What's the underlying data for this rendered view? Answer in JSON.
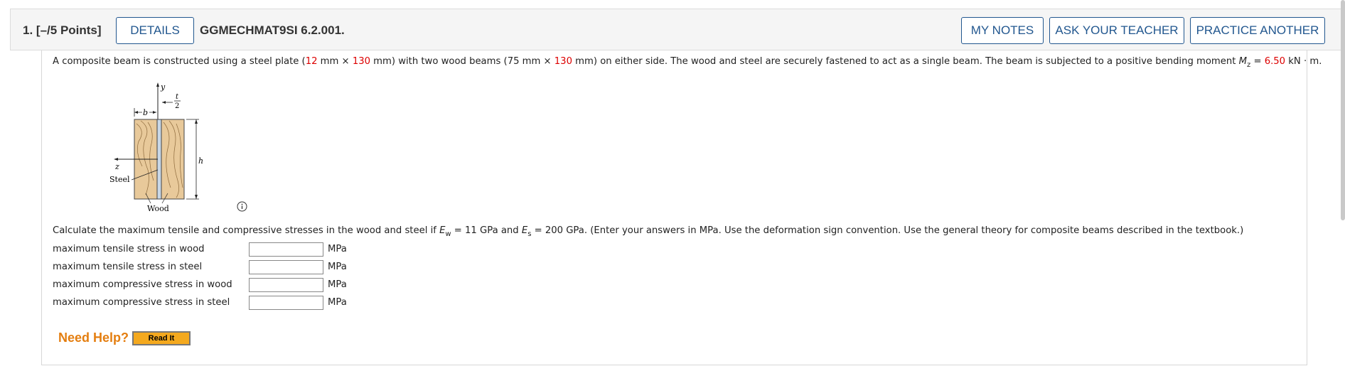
{
  "header": {
    "question_number": "1.",
    "points": "[–/5 Points]",
    "details_label": "DETAILS",
    "question_code": "GGMECHMAT9SI 6.2.001.",
    "my_notes_label": "MY NOTES",
    "ask_teacher_label": "ASK YOUR TEACHER",
    "practice_another_label": "PRACTICE ANOTHER"
  },
  "statement": {
    "p1": "A composite beam is constructed using a steel plate (",
    "plate_thickness": "12",
    "p2": " mm × ",
    "plate_height": "130",
    "p3": " mm) with two wood beams (75 mm × ",
    "wood_height": "130",
    "p4": " mm) on either side. The wood and steel are securely fastened to act as a single beam. The beam is subjected to a positive bending moment ",
    "moment_symbol": "M",
    "moment_sub": "z",
    "p5": " = ",
    "moment_value": "6.50",
    "p6": " kN · m."
  },
  "figure": {
    "label_y": "y",
    "label_t": "t",
    "label_2": "2",
    "label_b": "b",
    "label_h": "h",
    "label_z": "z",
    "label_steel": "Steel",
    "label_wood": "Wood"
  },
  "calc": {
    "p1": "Calculate the maximum tensile and compressive stresses in the wood and steel if ",
    "ew_symbol": "E",
    "ew_sub": "w",
    "p2": " = 11 GPa and ",
    "es_symbol": "E",
    "es_sub": "s",
    "p3": " = 200 GPa. (Enter your answers in MPa. Use the deformation sign convention. Use the general theory for composite beams described in the textbook.)"
  },
  "answers": [
    {
      "label": "maximum tensile stress in wood",
      "value": "",
      "unit": "MPa"
    },
    {
      "label": "maximum tensile stress in steel",
      "value": "",
      "unit": "MPa"
    },
    {
      "label": "maximum compressive stress in wood",
      "value": "",
      "unit": "MPa"
    },
    {
      "label": "maximum compressive stress in steel",
      "value": "",
      "unit": "MPa"
    }
  ],
  "help": {
    "need_help": "Need Help?",
    "read_it": "Read It"
  },
  "colors": {
    "accent": "#22578f",
    "value_red": "#dd0000",
    "help_orange": "#e47e10",
    "readit_bg": "#f4a91e",
    "wood": "#e8c99a"
  }
}
